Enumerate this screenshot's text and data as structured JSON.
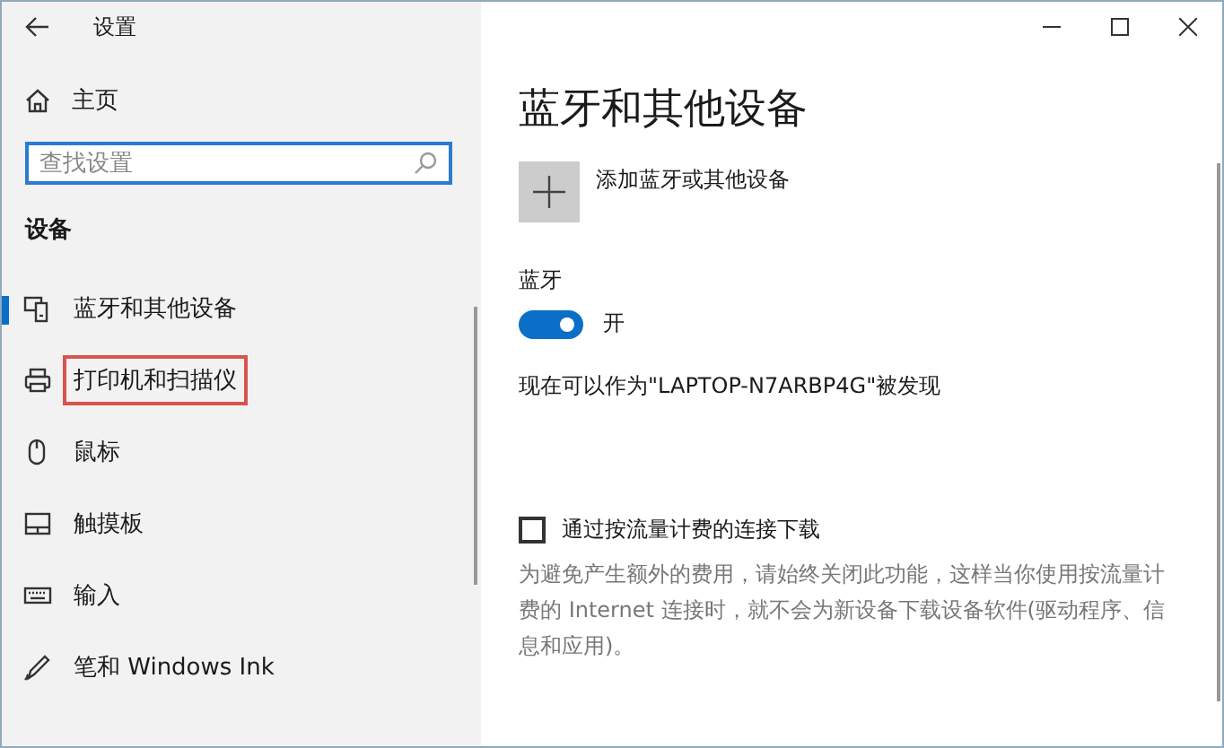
{
  "window": {
    "title": "设置"
  },
  "sidebar": {
    "home": "主页",
    "search": {
      "placeholder": "查找设置"
    },
    "section": "设备",
    "items": [
      {
        "label": "蓝牙和其他设备",
        "kind": "bluetooth",
        "selected": true,
        "highlighted": false
      },
      {
        "label": "打印机和扫描仪",
        "kind": "printer",
        "selected": false,
        "highlighted": true
      },
      {
        "label": "鼠标",
        "kind": "mouse",
        "selected": false,
        "highlighted": false
      },
      {
        "label": "触摸板",
        "kind": "touchpad",
        "selected": false,
        "highlighted": false
      },
      {
        "label": "输入",
        "kind": "keyboard",
        "selected": false,
        "highlighted": false
      },
      {
        "label": "笔和 Windows Ink",
        "kind": "pen",
        "selected": false,
        "highlighted": false
      }
    ]
  },
  "content": {
    "title": "蓝牙和其他设备",
    "add_device": "添加蓝牙或其他设备",
    "bluetooth_label": "蓝牙",
    "bluetooth_toggle": {
      "on": true,
      "state_text": "开"
    },
    "discoverable": "现在可以作为\"LAPTOP-N7ARBP4G\"被发现",
    "metered": {
      "label": "通过按流量计费的连接下载",
      "checked": false,
      "description": "为避免产生额外的费用，请始终关闭此功能，这样当你使用按流量计费的 Internet 连接时，就不会为新设备下载设备软件(驱动程序、信息和应用)。"
    }
  }
}
